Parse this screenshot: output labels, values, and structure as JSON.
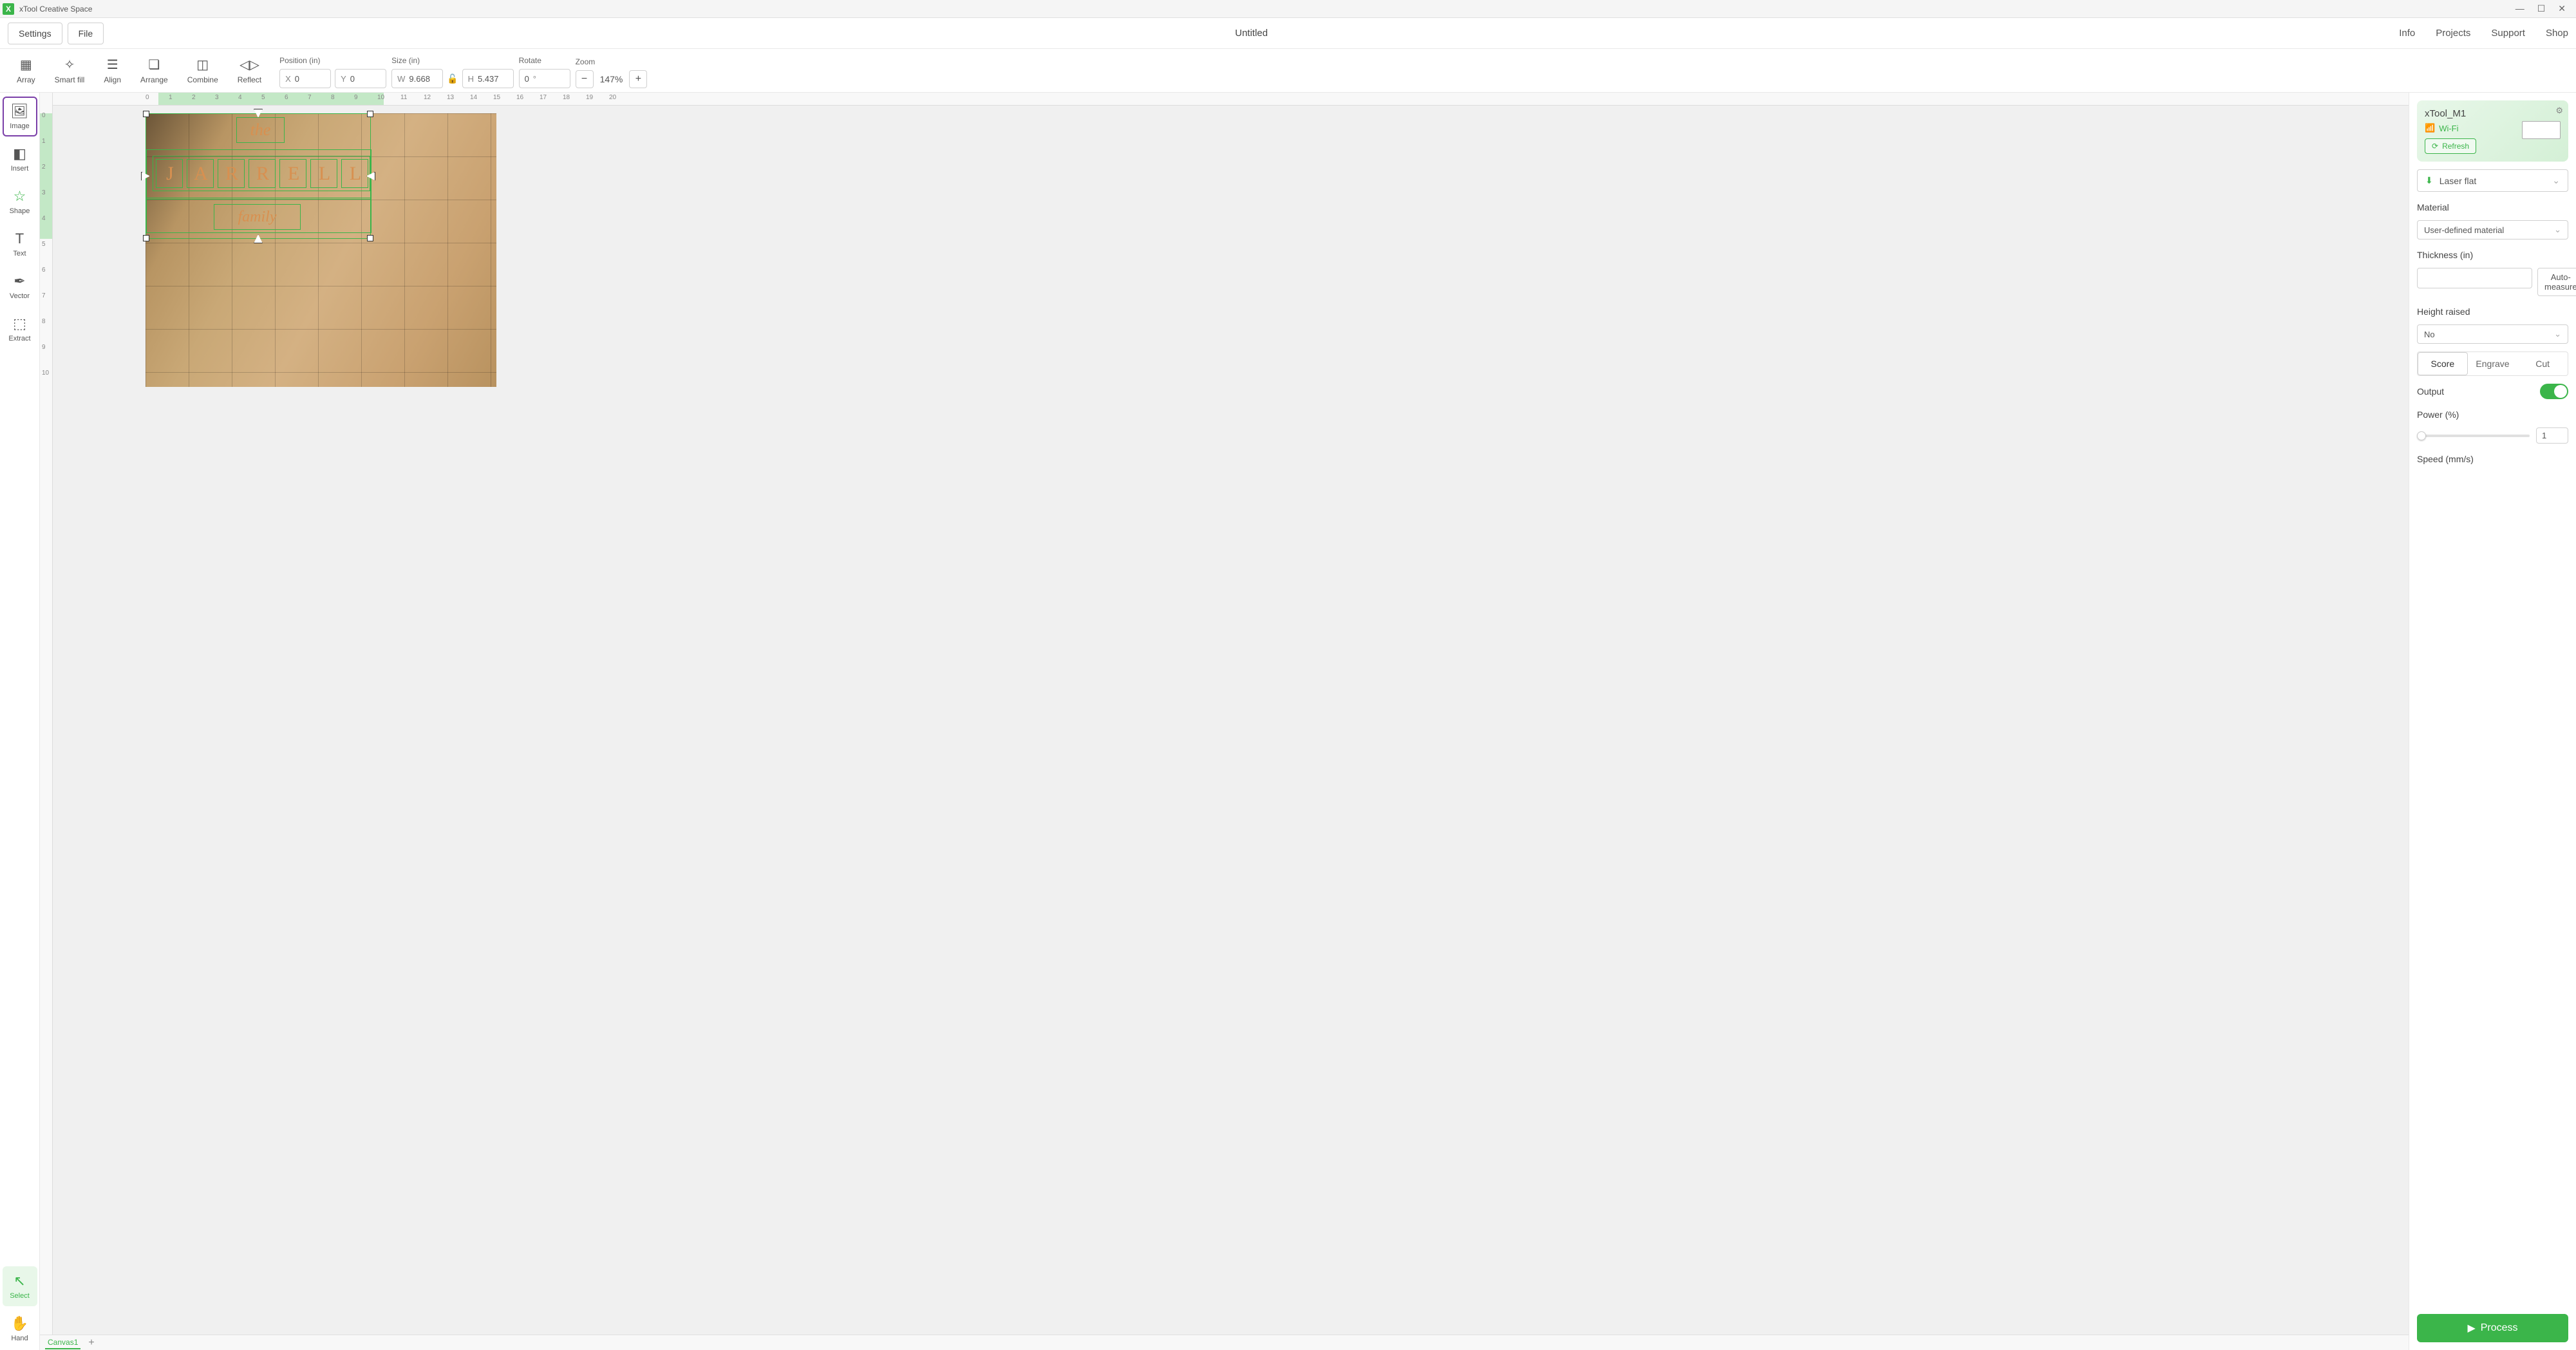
{
  "window": {
    "title": "xTool Creative Space",
    "document_title": "Untitled"
  },
  "menu": {
    "settings": "Settings",
    "file": "File",
    "nav": [
      "Info",
      "Projects",
      "Support",
      "Shop"
    ]
  },
  "ribbon": {
    "items": [
      "Array",
      "Smart fill",
      "Align",
      "Arrange",
      "Combine",
      "Reflect"
    ],
    "position": {
      "label": "Position (in)",
      "x_prefix": "X",
      "x": "0",
      "y_prefix": "Y",
      "y": "0"
    },
    "size": {
      "label": "Size (in)",
      "w_prefix": "W",
      "w": "9.668",
      "h_prefix": "H",
      "h": "5.437"
    },
    "rotate": {
      "label": "Rotate",
      "value": "0",
      "suffix": "°"
    },
    "zoom": {
      "label": "Zoom",
      "value": "147%",
      "minus": "−",
      "plus": "+"
    }
  },
  "sidebar": {
    "image": "Image",
    "insert": "Insert",
    "shape": "Shape",
    "text": "Text",
    "vector": "Vector",
    "extract": "Extract",
    "select": "Select",
    "hand": "Hand"
  },
  "canvas": {
    "tab": "Canvas1",
    "text_the": "the",
    "text_main": "JARRELL",
    "text_family": "family",
    "ruler_h": [
      "0",
      "1",
      "2",
      "3",
      "4",
      "5",
      "6",
      "7",
      "8",
      "9",
      "10",
      "11",
      "12",
      "13",
      "14",
      "15",
      "16",
      "17",
      "18",
      "19",
      "20"
    ],
    "ruler_v": [
      "0",
      "1",
      "2",
      "3",
      "4",
      "5",
      "6",
      "7",
      "8",
      "9",
      "10"
    ]
  },
  "device": {
    "name": "xTool_M1",
    "wifi": "Wi-Fi",
    "refresh": "Refresh"
  },
  "mode": {
    "label": "Laser flat"
  },
  "props": {
    "material_label": "Material",
    "material_value": "User-defined material",
    "thickness_label": "Thickness (in)",
    "automeasure": "Auto-measure",
    "height_label": "Height raised",
    "height_value": "No"
  },
  "ops": {
    "score": "Score",
    "engrave": "Engrave",
    "cut": "Cut",
    "output": "Output",
    "power_label": "Power (%)",
    "power_value": "1",
    "speed_label": "Speed (mm/s)"
  },
  "process": "Process"
}
